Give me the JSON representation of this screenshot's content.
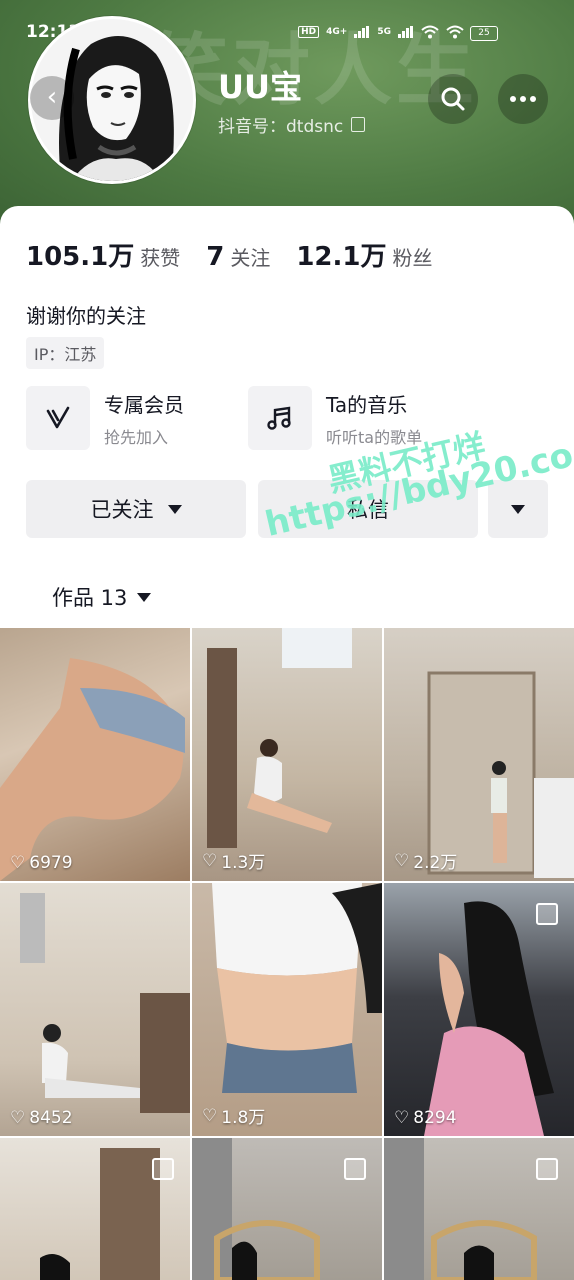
{
  "status_bar": {
    "time": "12:13",
    "hd": "HD",
    "net1": "4G+",
    "net2": "5G",
    "battery": "25"
  },
  "header": {
    "background_word": "笑对人生",
    "username": "UU宝",
    "account_id": "抖音号：dtdsnc",
    "accent_color": "#4e7a43"
  },
  "stats": [
    {
      "value": "105.1万",
      "label": "获赞"
    },
    {
      "value": "7",
      "label": "关注"
    },
    {
      "value": "12.1万",
      "label": "粉丝"
    }
  ],
  "bio": "谢谢你的关注",
  "ip_tag": "IP：江苏",
  "features": [
    {
      "title": "专属会员",
      "subtitle": "抢先加入",
      "icon": "vip-v-icon"
    },
    {
      "title": "Ta的音乐",
      "subtitle": "听听ta的歌单",
      "icon": "music-note-icon"
    }
  ],
  "actions": {
    "followed_label": "已关注",
    "message_label": "私信"
  },
  "tabs": {
    "works_label": "作品 13"
  },
  "watermark": {
    "line1": "黑料不打烊",
    "line2": "https://bdy20.co"
  },
  "posts": [
    {
      "likes": "6979",
      "multi_image": false
    },
    {
      "likes": "1.3万",
      "multi_image": false
    },
    {
      "likes": "2.2万",
      "multi_image": false
    },
    {
      "likes": "8452",
      "multi_image": false
    },
    {
      "likes": "1.8万",
      "multi_image": false
    },
    {
      "likes": "8294",
      "multi_image": true
    },
    {
      "likes": "",
      "multi_image": true
    },
    {
      "likes": "",
      "multi_image": true
    },
    {
      "likes": "",
      "multi_image": true
    }
  ]
}
